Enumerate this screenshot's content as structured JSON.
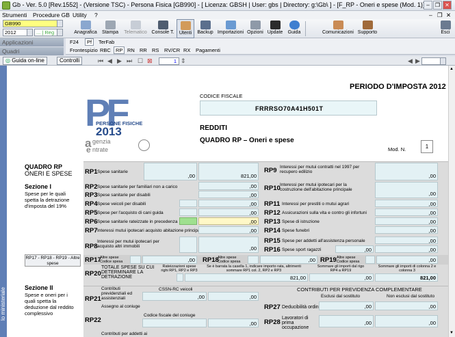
{
  "window": {
    "title": "Gb - Ver. 5.0 [Rev.1552] - (Versione TSC) - Persona Fisica [GB990] - [ Licenza: GBSH | User: gbs | Directory: g:\\Gb\\ ] - [F_RP - Oneri e spese (Mod. 1)]",
    "minimize": "–",
    "restore": "❐",
    "close": "✕",
    "child_minimize": "–",
    "child_restore": "❐",
    "child_close": "✕"
  },
  "menu": [
    "Strumenti",
    "Procedure GB",
    "Utility",
    "?"
  ],
  "combos": {
    "model": "GB990",
    "year": "2012",
    "year_suffix": "... | Reg"
  },
  "toolbar": {
    "anagrafica": "Anagrafica",
    "stampa": "Stampa",
    "telematico": "Telematico",
    "console": "Console T.",
    "utenti": "Utenti",
    "backup": "Backup",
    "importazioni": "Importazioni",
    "opzioni": "Opzioni",
    "update": "Update",
    "guida": "Guida",
    "comunicazioni": "Comunicazioni",
    "supporto": "Supporto",
    "esci": "Esci"
  },
  "left_bars": {
    "applicazioni": "Applicazioni",
    "quadri": "Quadri"
  },
  "tabs_row1": [
    "F24",
    "Pf",
    "TerFab"
  ],
  "tabs_row2": [
    "Frontespizio",
    "RBC",
    "RP",
    "RN",
    "RR",
    "RS",
    "RV/CR",
    "RX",
    "Pagamenti"
  ],
  "guide": {
    "online": "Guida on-line",
    "controlli": "Controlli",
    "page": "1"
  },
  "form": {
    "logo_pf": "PF",
    "logo_line": "PERSONE FISICHE",
    "logo_year": "2013",
    "agenzia": "genzia",
    "entrate": "ntrate",
    "periodo": "PERIODO D'IMPOSTA 2012",
    "cf_label": "CODICE FISCALE",
    "cf_value": "FRRRSO70A41H501T",
    "redditi": "REDDITI",
    "quadro": "QUADRO RP",
    "quadro_sub": "– Oneri e spese",
    "mod_label": "Mod. N.",
    "mod_value": "1",
    "sec_title": "QUADRO RP",
    "sec_title2": "ONERI E SPESE",
    "sez1": "Sezione I",
    "sez1_desc": "Spese per le quali spetta la detrazione d'imposta del 19%",
    "rp17_button": "RP17 - RP18 - RP19 - Altre spese",
    "sez2": "Sezione II",
    "sez2_desc": "Spese e oneri per i quali spetta la deduzione dal reddito complessivo",
    "ministeriale": "lo ministeriale",
    "zero": ",00",
    "rp1": "RP1",
    "rp1_l": "Spese sanitarie",
    "rp1_v": "821,00",
    "rp2": "RP2",
    "rp2_l": "Spese sanitarie per familiari non a carico",
    "rp3": "RP3",
    "rp3_l": "Spese sanitarie per disabili",
    "rp4": "RP4",
    "rp4_l": "Spese veicoli per disabili",
    "rp5": "RP5",
    "rp5_l": "Spese per l'acquisto di cani guida",
    "rp6": "RP6",
    "rp6_l": "Spese sanitarie rateizzate in precedenza",
    "rp7": "RP7",
    "rp7_l": "Interessi mutui ipotecari acquisto abitazione principale",
    "rp8": "RP8",
    "rp8_l": "Interessi per mutui ipotecari per acquisto altri immobili",
    "rp9": "RP9",
    "rp9_l": "Interessi per mutui contratti nel 1997 per recupero edilizio",
    "rp10": "RP10",
    "rp10_l": "Interessi per mutui ipotecari per la costruzione dell'abitazione principale",
    "rp11": "RP11",
    "rp11_l": "Interessi per prestiti o mutui agrari",
    "rp12": "RP12",
    "rp12_l": "Assicurazioni sulla vita e contro gli infortuni",
    "rp13": "RP13",
    "rp13_l": "Spese di istruzione",
    "rp14": "RP14",
    "rp14_l": "Spese funebri",
    "rp15": "RP15",
    "rp15_l": "Spese per addetti all'assistenza personale",
    "rp16": "RP16",
    "rp16_l": "Spese sport ragazzi",
    "rp17": "RP17",
    "rp18": "RP18",
    "rp19": "RP19",
    "altre_spese": "Altre spese",
    "codice_spesa": "Codice spesa",
    "rp20": "RP20",
    "rp20_l": "TOTALE SPESE SU CUI DETERMINARE LA DETRAZIONE",
    "rp20_c1": "Rateizzazioni spese righi RP1, RP2 e RP3",
    "rp20_c2": "Se è barrata la casella 1, indicare importo rata, altrimenti sommare RP1 col. 2, RP2 e RP3",
    "rp20_c3": "Sommare gli importi dal rigo RP4 a RP19",
    "rp20_c4": "Sommare gli importi di colonna 2 e colonna 3",
    "rp20_v2": "821,00",
    "rp20_v4": "821,00",
    "rp21": "RP21",
    "rp21_l": "Contributi previdenziali ed assistenziali",
    "cssn": "CSSN-RC veicoli",
    "rp22": "RP22",
    "rp22_l": "Assegno al coniuge",
    "cf_coniuge": "Codice fiscale del coniuge",
    "rp23_l": "Contributi per addetti ai",
    "prev_compl": "CONTRIBUTI PER PREVIDENZA COMPLEMENTARE",
    "esclusi": "Esclusi dal sostituto",
    "non_esclusi": "Non esclusi dal sostituto",
    "rp27": "RP27",
    "rp27_l": "Deducibilità ordinaria",
    "rp28": "RP28",
    "rp28_l": "Lavoratori di prima occupazione"
  }
}
